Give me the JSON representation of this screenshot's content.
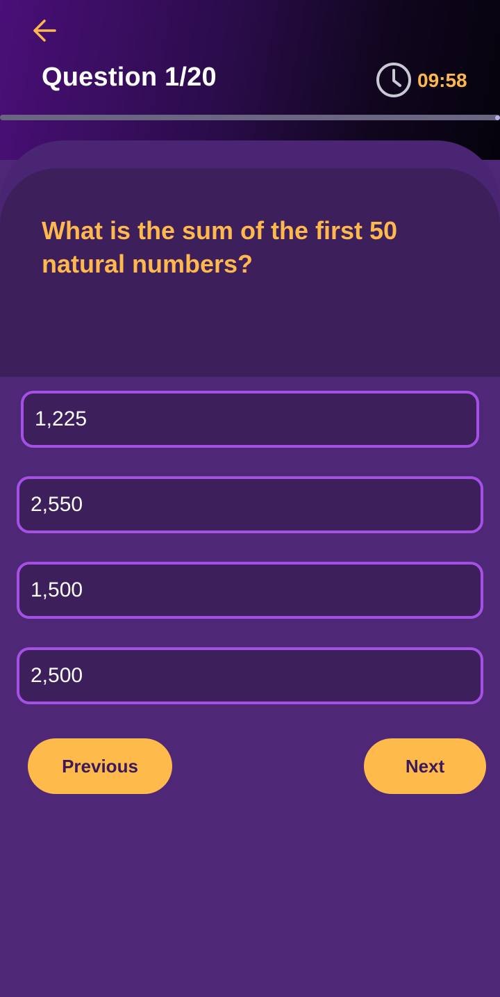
{
  "header": {
    "back_icon": "arrow-left-icon",
    "title": "Question 1/20",
    "timer_icon": "clock-icon",
    "timer": "09:58",
    "progress_fraction": 1.0
  },
  "question": {
    "text": "What is the sum of the first 50 natural numbers?"
  },
  "options": [
    {
      "label": "1,225"
    },
    {
      "label": "2,550"
    },
    {
      "label": "1,500"
    },
    {
      "label": "2,500"
    }
  ],
  "navigation": {
    "previous_label": "Previous",
    "next_label": "Next"
  },
  "colors": {
    "accent": "#FFB84D",
    "background": "#4F2777",
    "option_border": "#A550E4",
    "option_fill": "#3C1F5B"
  }
}
